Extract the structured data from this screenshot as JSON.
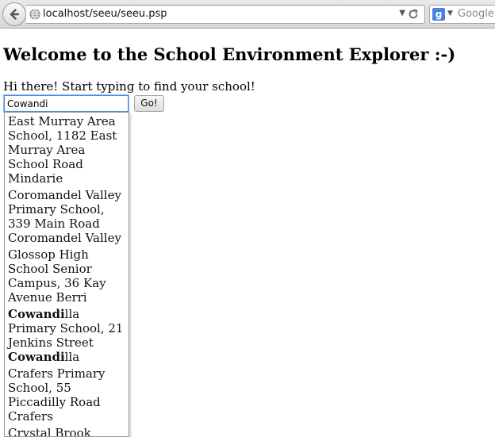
{
  "browser": {
    "url": "localhost/seeu/seeu.psp",
    "search_placeholder": "Google",
    "search_engine_letter": "g"
  },
  "page": {
    "heading": "Welcome to the School Environment Explorer :-)",
    "intro": "Hi there! Start typing to find your school!",
    "search_value": "Cowandi",
    "go_label": "Go!"
  },
  "suggestions": [
    {
      "pre": "East Murray Area School, 1182 East Murray Area School Road Mindarie",
      "bold": "",
      "post": ""
    },
    {
      "pre": "Coromandel Valley Primary School, 339 Main Road Coromandel Valley",
      "bold": "",
      "post": ""
    },
    {
      "pre": "Glossop High School Senior Campus, 36 Kay Avenue Berri",
      "bold": "",
      "post": ""
    },
    {
      "pre": "",
      "bold": "Cowandi",
      "post": "lla Primary School, 21 Jenkins Street ",
      "bold2": "Cowandi",
      "post2": "lla"
    },
    {
      "pre": "Crafers Primary School, 55 Piccadilly Road Crafers",
      "bold": "",
      "post": ""
    },
    {
      "pre": "Crystal Brook",
      "bold": "",
      "post": ""
    }
  ]
}
